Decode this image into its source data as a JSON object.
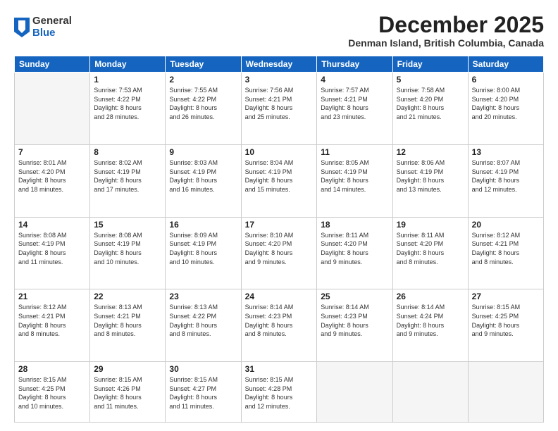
{
  "header": {
    "logo_general": "General",
    "logo_blue": "Blue",
    "month_title": "December 2025",
    "location": "Denman Island, British Columbia, Canada"
  },
  "weekdays": [
    "Sunday",
    "Monday",
    "Tuesday",
    "Wednesday",
    "Thursday",
    "Friday",
    "Saturday"
  ],
  "weeks": [
    [
      {
        "day": "",
        "info": ""
      },
      {
        "day": "1",
        "info": "Sunrise: 7:53 AM\nSunset: 4:22 PM\nDaylight: 8 hours\nand 28 minutes."
      },
      {
        "day": "2",
        "info": "Sunrise: 7:55 AM\nSunset: 4:22 PM\nDaylight: 8 hours\nand 26 minutes."
      },
      {
        "day": "3",
        "info": "Sunrise: 7:56 AM\nSunset: 4:21 PM\nDaylight: 8 hours\nand 25 minutes."
      },
      {
        "day": "4",
        "info": "Sunrise: 7:57 AM\nSunset: 4:21 PM\nDaylight: 8 hours\nand 23 minutes."
      },
      {
        "day": "5",
        "info": "Sunrise: 7:58 AM\nSunset: 4:20 PM\nDaylight: 8 hours\nand 21 minutes."
      },
      {
        "day": "6",
        "info": "Sunrise: 8:00 AM\nSunset: 4:20 PM\nDaylight: 8 hours\nand 20 minutes."
      }
    ],
    [
      {
        "day": "7",
        "info": "Sunrise: 8:01 AM\nSunset: 4:20 PM\nDaylight: 8 hours\nand 18 minutes."
      },
      {
        "day": "8",
        "info": "Sunrise: 8:02 AM\nSunset: 4:19 PM\nDaylight: 8 hours\nand 17 minutes."
      },
      {
        "day": "9",
        "info": "Sunrise: 8:03 AM\nSunset: 4:19 PM\nDaylight: 8 hours\nand 16 minutes."
      },
      {
        "day": "10",
        "info": "Sunrise: 8:04 AM\nSunset: 4:19 PM\nDaylight: 8 hours\nand 15 minutes."
      },
      {
        "day": "11",
        "info": "Sunrise: 8:05 AM\nSunset: 4:19 PM\nDaylight: 8 hours\nand 14 minutes."
      },
      {
        "day": "12",
        "info": "Sunrise: 8:06 AM\nSunset: 4:19 PM\nDaylight: 8 hours\nand 13 minutes."
      },
      {
        "day": "13",
        "info": "Sunrise: 8:07 AM\nSunset: 4:19 PM\nDaylight: 8 hours\nand 12 minutes."
      }
    ],
    [
      {
        "day": "14",
        "info": "Sunrise: 8:08 AM\nSunset: 4:19 PM\nDaylight: 8 hours\nand 11 minutes."
      },
      {
        "day": "15",
        "info": "Sunrise: 8:08 AM\nSunset: 4:19 PM\nDaylight: 8 hours\nand 10 minutes."
      },
      {
        "day": "16",
        "info": "Sunrise: 8:09 AM\nSunset: 4:19 PM\nDaylight: 8 hours\nand 10 minutes."
      },
      {
        "day": "17",
        "info": "Sunrise: 8:10 AM\nSunset: 4:20 PM\nDaylight: 8 hours\nand 9 minutes."
      },
      {
        "day": "18",
        "info": "Sunrise: 8:11 AM\nSunset: 4:20 PM\nDaylight: 8 hours\nand 9 minutes."
      },
      {
        "day": "19",
        "info": "Sunrise: 8:11 AM\nSunset: 4:20 PM\nDaylight: 8 hours\nand 8 minutes."
      },
      {
        "day": "20",
        "info": "Sunrise: 8:12 AM\nSunset: 4:21 PM\nDaylight: 8 hours\nand 8 minutes."
      }
    ],
    [
      {
        "day": "21",
        "info": "Sunrise: 8:12 AM\nSunset: 4:21 PM\nDaylight: 8 hours\nand 8 minutes."
      },
      {
        "day": "22",
        "info": "Sunrise: 8:13 AM\nSunset: 4:21 PM\nDaylight: 8 hours\nand 8 minutes."
      },
      {
        "day": "23",
        "info": "Sunrise: 8:13 AM\nSunset: 4:22 PM\nDaylight: 8 hours\nand 8 minutes."
      },
      {
        "day": "24",
        "info": "Sunrise: 8:14 AM\nSunset: 4:23 PM\nDaylight: 8 hours\nand 8 minutes."
      },
      {
        "day": "25",
        "info": "Sunrise: 8:14 AM\nSunset: 4:23 PM\nDaylight: 8 hours\nand 9 minutes."
      },
      {
        "day": "26",
        "info": "Sunrise: 8:14 AM\nSunset: 4:24 PM\nDaylight: 8 hours\nand 9 minutes."
      },
      {
        "day": "27",
        "info": "Sunrise: 8:15 AM\nSunset: 4:25 PM\nDaylight: 8 hours\nand 9 minutes."
      }
    ],
    [
      {
        "day": "28",
        "info": "Sunrise: 8:15 AM\nSunset: 4:25 PM\nDaylight: 8 hours\nand 10 minutes."
      },
      {
        "day": "29",
        "info": "Sunrise: 8:15 AM\nSunset: 4:26 PM\nDaylight: 8 hours\nand 11 minutes."
      },
      {
        "day": "30",
        "info": "Sunrise: 8:15 AM\nSunset: 4:27 PM\nDaylight: 8 hours\nand 11 minutes."
      },
      {
        "day": "31",
        "info": "Sunrise: 8:15 AM\nSunset: 4:28 PM\nDaylight: 8 hours\nand 12 minutes."
      },
      {
        "day": "",
        "info": ""
      },
      {
        "day": "",
        "info": ""
      },
      {
        "day": "",
        "info": ""
      }
    ]
  ]
}
